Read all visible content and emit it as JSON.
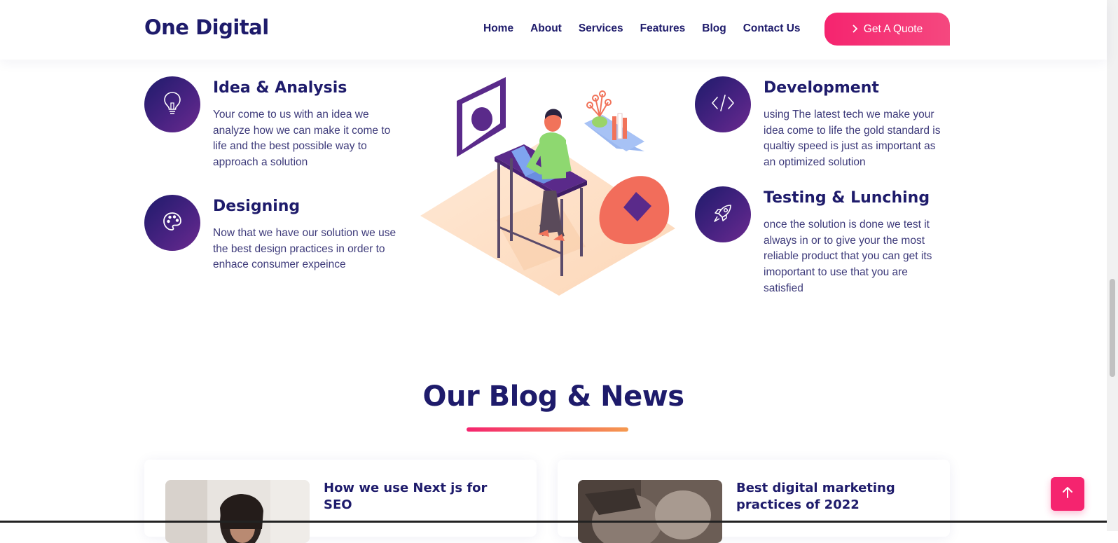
{
  "header": {
    "logo": "One Digital",
    "nav": [
      "Home",
      "About",
      "Services",
      "Features",
      "Blog",
      "Contact Us"
    ],
    "quote_button": "Get A Quote"
  },
  "features": [
    {
      "title": "Idea & Analysis",
      "icon": "lightbulb-icon",
      "description": "Your come to us with an idea we analyze how we can make it come to life and the best possible way to approach a solution"
    },
    {
      "title": "Designing",
      "icon": "palette-icon",
      "description": "Now that we have our solution we use the best design practices in order to enhace consumer expeince"
    },
    {
      "title": "Development",
      "icon": "code-icon",
      "description": "using The latest tech we make your idea come to life the gold standard is qualtiy speed is just as important as an optimized solution"
    },
    {
      "title": "Testing & Lunching",
      "icon": "rocket-icon",
      "description": "once the solution is done we test it always in or to give your the most reliable product that you can get its imoportant to use that you are satisfied"
    }
  ],
  "blog": {
    "heading": "Our Blog & News",
    "posts": [
      {
        "title": "How we use Next js for SEO"
      },
      {
        "title": "Best digital marketing practices of 2022"
      }
    ]
  },
  "colors": {
    "navy": "#1e1b6b",
    "pink": "#f5246f",
    "orange": "#f59a4f",
    "purple": "#6a2a8e"
  }
}
